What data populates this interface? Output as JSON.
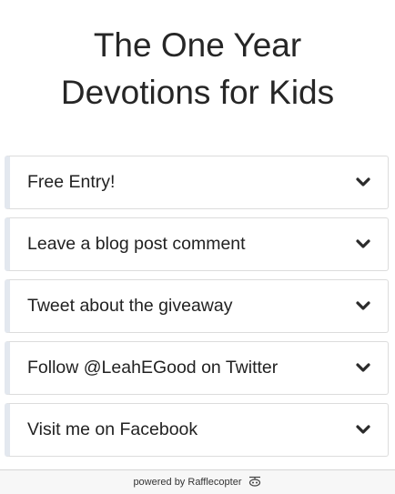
{
  "widget": {
    "title_line1": "The One Year",
    "title_line2": "Devotions for Kids"
  },
  "entries": [
    {
      "label": "Free Entry!",
      "icon": "chevron-down-icon"
    },
    {
      "label": "Leave a blog post comment",
      "icon": "chevron-down-icon"
    },
    {
      "label": "Tweet about the giveaway",
      "icon": "chevron-down-icon"
    },
    {
      "label": "Follow @LeahEGood on Twitter",
      "icon": "chevron-down-icon"
    },
    {
      "label": "Visit me on Facebook",
      "icon": "chevron-down-icon"
    }
  ],
  "footer": {
    "powered_by": "powered by",
    "brand": "Rafflecopter",
    "logo_icon": "rafflecopter-logo-icon"
  }
}
